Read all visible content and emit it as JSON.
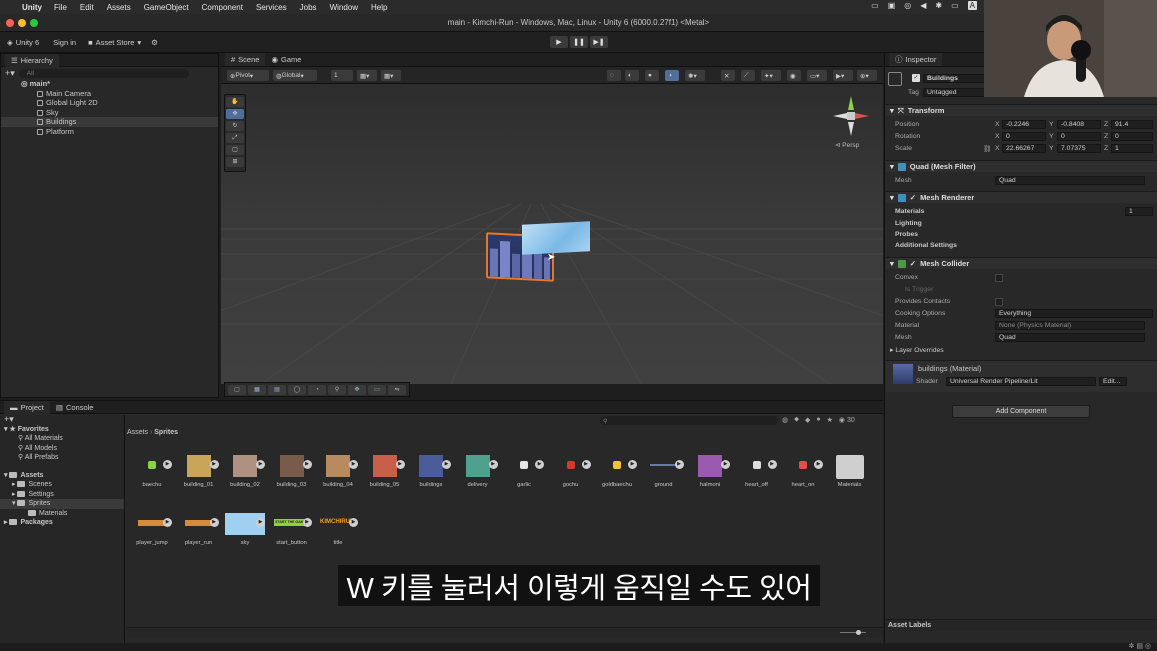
{
  "menubar": {
    "app": "Unity",
    "items": [
      "File",
      "Edit",
      "Assets",
      "GameObject",
      "Component",
      "Services",
      "Jobs",
      "Window",
      "Help"
    ]
  },
  "window": {
    "title": "main - Kimchi-Run - Windows, Mac, Linux - Unity 6 (6000.0.27f1) <Metal>"
  },
  "toolbar": {
    "unity_label": "Unity 6",
    "signin": "Sign in",
    "asset_store": "Asset Store"
  },
  "hierarchy": {
    "tab": "Hierarchy",
    "search_placeholder": "All",
    "scene": "main*",
    "items": [
      "Main Camera",
      "Global Light 2D",
      "Sky",
      "Buildings",
      "Platform"
    ],
    "selected": "Buildings"
  },
  "scene_view": {
    "tabs": [
      "Scene",
      "Game"
    ],
    "pivot": "Pivot",
    "global": "Global",
    "grid_num": "1",
    "persp": "Persp"
  },
  "inspector": {
    "tab": "Inspector",
    "object_name": "Buildings",
    "tag_label": "Tag",
    "tag_value": "Untagged",
    "transform": {
      "title": "Transform",
      "position_label": "Position",
      "rotation_label": "Rotation",
      "scale_label": "Scale",
      "position": {
        "x": "-0.2246",
        "y": "-0.8408",
        "z": "91.4"
      },
      "rotation": {
        "x": "0",
        "y": "0",
        "z": "0"
      },
      "scale": {
        "x": "22.66267",
        "y": "7.07375",
        "z": "1"
      }
    },
    "mesh_filter": {
      "title": "Quad (Mesh Filter)",
      "mesh_label": "Mesh",
      "mesh": "Quad"
    },
    "mesh_renderer": {
      "title": "Mesh Renderer",
      "materials": "Materials",
      "materials_count": "1",
      "lighting": "Lighting",
      "probes": "Probes",
      "additional": "Additional Settings"
    },
    "mesh_collider": {
      "title": "Mesh Collider",
      "convex": "Convex",
      "is_trigger": "Is Trigger",
      "provides_contacts": "Provides Contacts",
      "cooking_label": "Cooking Options",
      "cooking_value": "Everything",
      "material_label": "Material",
      "material_value": "None (Physics Material)",
      "mesh_label": "Mesh",
      "mesh_value": "Quad",
      "layer_overrides": "Layer Overrides"
    },
    "material": {
      "name": "buildings (Material)",
      "shader_label": "Shader",
      "shader_value": "Universal Render Pipeline/Lit",
      "edit": "Edit..."
    },
    "add_component": "Add Component",
    "asset_labels": "Asset Labels"
  },
  "project": {
    "tabs": [
      "Project",
      "Console"
    ],
    "tree": {
      "favorites": "Favorites",
      "fav_items": [
        "All Materials",
        "All Models",
        "All Prefabs"
      ],
      "assets": "Assets",
      "asset_folders": [
        "Scenes",
        "Settings",
        "Sprites"
      ],
      "sprites_child": "Materials",
      "packages": "Packages"
    },
    "breadcrumb": [
      "Assets",
      "Sprites"
    ],
    "count": "30",
    "assets_row1": [
      "baechu",
      "building_01",
      "building_02",
      "building_03",
      "building_04",
      "building_05",
      "buildings",
      "delivery",
      "garlic",
      "gochu",
      "goldbaechu",
      "ground",
      "halmoni",
      "heart_off",
      "heart_on",
      "Materials"
    ],
    "assets_row2": [
      "player_jump",
      "player_run",
      "sky",
      "start_button",
      "title"
    ],
    "start_button_text": "START THE GAME",
    "title_text": "KIMCHIRUN"
  },
  "subtitle": "W 키를 눌러서 이렇게 움직일 수도 있어"
}
